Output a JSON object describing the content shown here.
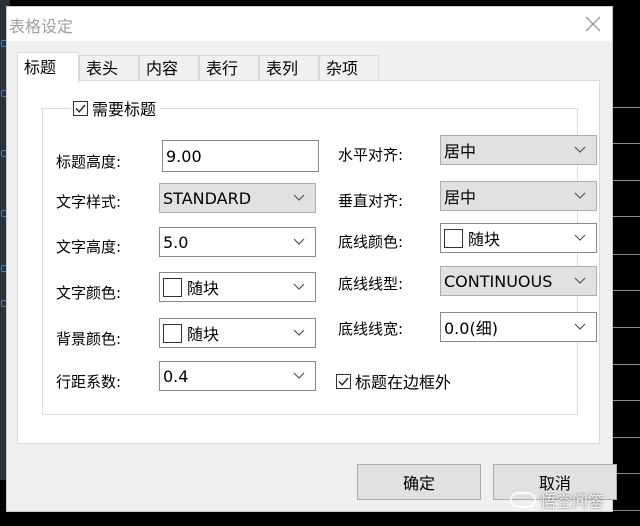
{
  "dialog": {
    "title": "表格设定",
    "tabs": [
      {
        "label": "标题",
        "active": true
      },
      {
        "label": "表头",
        "active": false
      },
      {
        "label": "内容",
        "active": false
      },
      {
        "label": "表行",
        "active": false
      },
      {
        "label": "表列",
        "active": false
      },
      {
        "label": "杂项",
        "active": false
      }
    ],
    "group": {
      "checkbox_label": "需要标题",
      "checked": true
    },
    "left_fields": [
      {
        "label": "标题高度:",
        "value": "9.00",
        "type": "text"
      },
      {
        "label": "文字样式:",
        "value": "STANDARD",
        "type": "select-disabled"
      },
      {
        "label": "文字高度:",
        "value": "5.0",
        "type": "select"
      },
      {
        "label": "文字颜色:",
        "value": "随块",
        "type": "color-select"
      },
      {
        "label": "背景颜色:",
        "value": "随块",
        "type": "color-select"
      },
      {
        "label": "行距系数:",
        "value": "0.4",
        "type": "select"
      }
    ],
    "right_fields": [
      {
        "label": "水平对齐:",
        "value": "居中",
        "type": "select-disabled"
      },
      {
        "label": "垂直对齐:",
        "value": "居中",
        "type": "select-disabled"
      },
      {
        "label": "底线颜色:",
        "value": "随块",
        "type": "color-select"
      },
      {
        "label": "底线线型:",
        "value": "CONTINUOUS",
        "type": "select-disabled"
      },
      {
        "label": "底线线宽:",
        "value": "0.0(细)",
        "type": "select"
      }
    ],
    "outside_checkbox": {
      "label": "标题在边框外",
      "checked": true
    },
    "buttons": {
      "ok": "确定",
      "cancel": "取消"
    }
  },
  "watermark": "悟空问答"
}
